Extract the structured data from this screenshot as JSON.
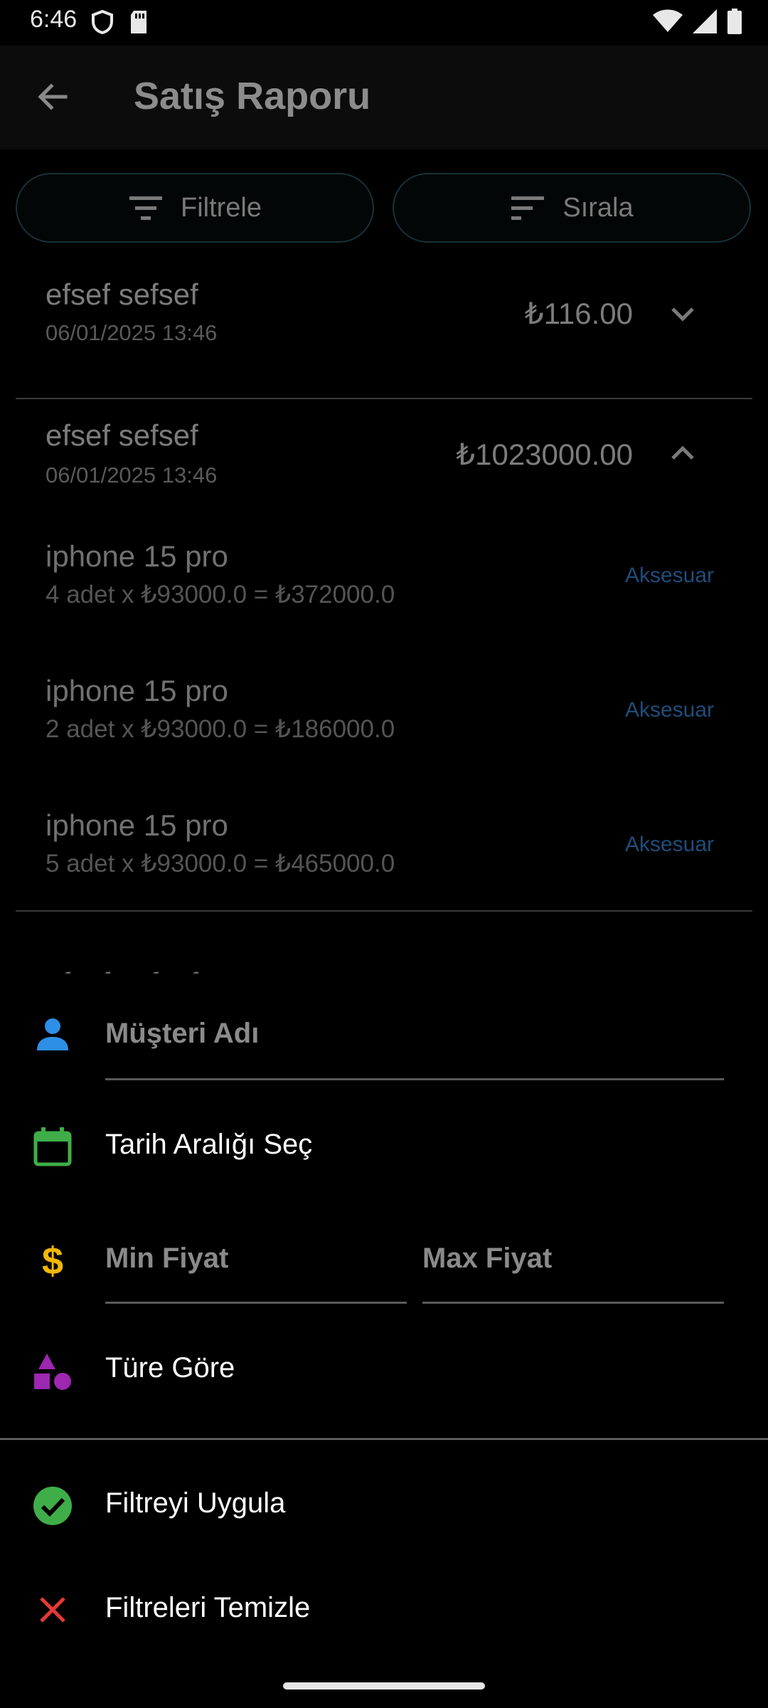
{
  "status_bar": {
    "time": "6:46",
    "icons": [
      "shield-icon",
      "sd-card-icon",
      "wifi-icon",
      "signal-icon",
      "battery-icon"
    ]
  },
  "app_bar": {
    "title": "Satış Raporu"
  },
  "toolbar": {
    "filter_label": "Filtrele",
    "sort_label": "Sırala"
  },
  "sales": [
    {
      "customer": "efsef sefsef",
      "date": "06/01/2025 13:46",
      "total": "₺116.00",
      "expanded": false
    },
    {
      "customer": "efsef sefsef",
      "date": "06/01/2025 13:46",
      "total": "₺1023000.00",
      "expanded": true,
      "items": [
        {
          "name": "iphone 15 pro",
          "detail": "4 adet x ₺93000.0 = ₺372000.0",
          "category": "Aksesuar"
        },
        {
          "name": "iphone 15 pro",
          "detail": "2 adet x ₺93000.0 = ₺186000.0",
          "category": "Aksesuar"
        },
        {
          "name": "iphone 15 pro",
          "detail": "5 adet x ₺93000.0 = ₺465000.0",
          "category": "Aksesuar"
        }
      ]
    },
    {
      "customer": "efsef sefsef"
    }
  ],
  "filter_sheet": {
    "customer_placeholder": "Müşteri Adı",
    "date_range_label": "Tarih Aralığı Seç",
    "min_price_placeholder": "Min Fiyat",
    "max_price_placeholder": "Max Fiyat",
    "type_label": "Türe Göre",
    "apply_label": "Filtreyi Uygula",
    "clear_label": "Filtreleri Temizle"
  },
  "colors": {
    "person_icon": "#2e8fe6",
    "calendar_icon": "#3fae49",
    "dollar_icon": "#f2b705",
    "shapes_icon": "#9c27b0",
    "check_icon": "#3fae49",
    "close_icon": "#e53935",
    "category_link": "#1f4d7a"
  }
}
